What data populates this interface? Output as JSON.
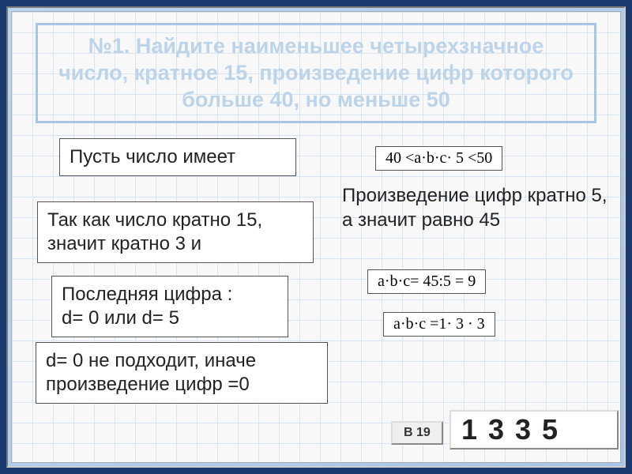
{
  "title": "№1. Найдите наименьшее четырехзначное число, кратное 15, произведение цифр которого больше 40, но меньше 50",
  "cards": {
    "c1": "Пусть число имеет",
    "c2": "Так как  число кратно 15,",
    "c2b": "значит кратно 3 и",
    "c3": "Последняя цифра :",
    "c3b": "d= 0 или d= 5",
    "c4": "d= 0  не подходит, иначе произведение цифр =0"
  },
  "righttext": "Произведение цифр кратно 5, а значит равно 45",
  "formulas": {
    "f1": "40 <a·b·c· 5 <50",
    "f2": "a·b·c= 45:5 = 9",
    "f3": "a·b·c =1· 3 · 3"
  },
  "badge": "В 19",
  "answer": [
    "1",
    "3",
    "3",
    "5"
  ]
}
